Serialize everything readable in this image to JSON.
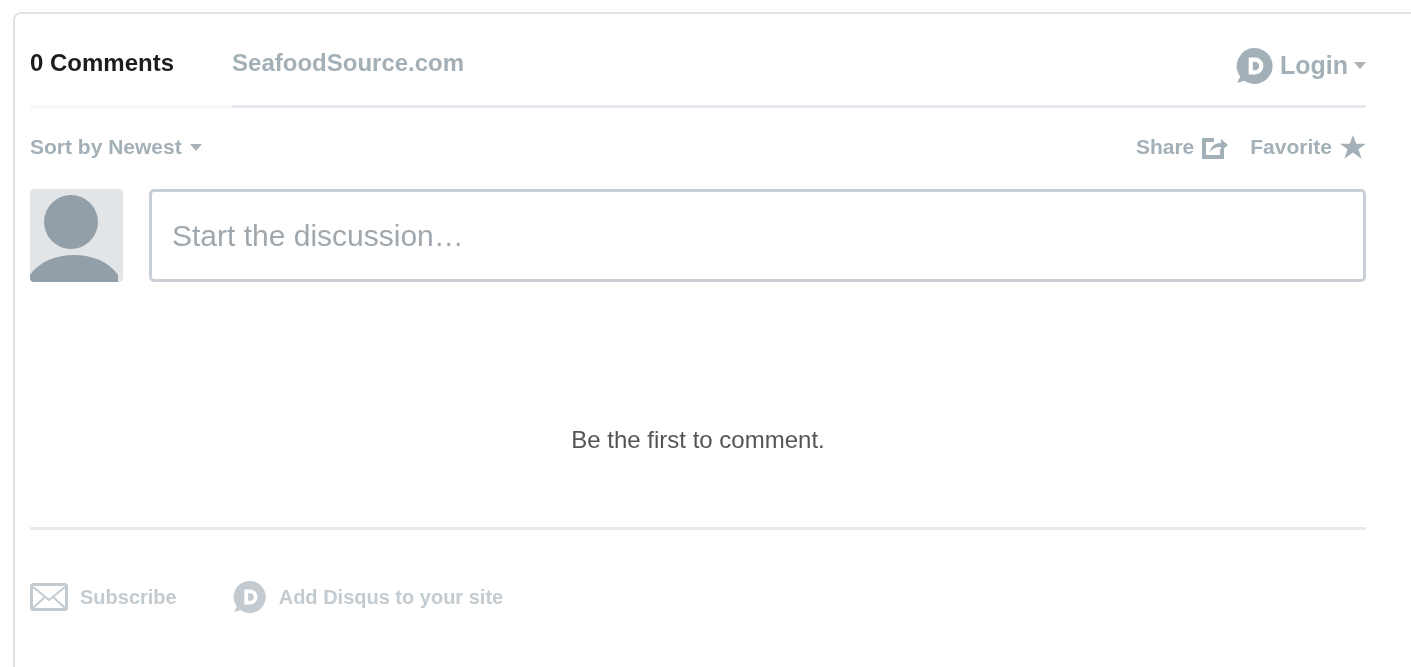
{
  "tabs": [
    {
      "label": "0 Comments",
      "selected": true
    },
    {
      "label": "SeafoodSource.com",
      "selected": false
    }
  ],
  "login": {
    "label": "Login"
  },
  "sort": {
    "label": "Sort by Newest"
  },
  "actions": [
    {
      "kind": "share",
      "label": "Share"
    },
    {
      "kind": "favorite",
      "label": "Favorite"
    }
  ],
  "composer": {
    "placeholder": "Start the discussion…"
  },
  "empty_message": "Be the first to comment.",
  "footer_links": [
    {
      "kind": "subscribe",
      "label": "Subscribe"
    },
    {
      "kind": "disqus",
      "label": "Add Disqus to your site"
    }
  ]
}
